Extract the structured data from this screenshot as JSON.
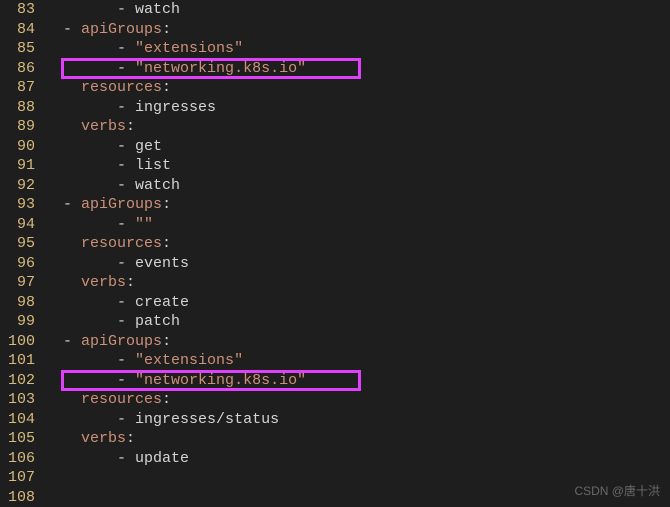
{
  "lines": [
    {
      "num": "83",
      "indent": "        ",
      "dash": "- ",
      "text": "watch",
      "type": "val"
    },
    {
      "num": "84",
      "indent": "  ",
      "dash": "- ",
      "key": "apiGroups",
      "colon": ":"
    },
    {
      "num": "85",
      "indent": "        ",
      "dash": "- ",
      "text": "\"extensions\"",
      "type": "str"
    },
    {
      "num": "86",
      "indent": "        ",
      "dash": "- ",
      "text": "\"networking.k8s.io\"",
      "type": "str",
      "highlight": true
    },
    {
      "num": "87",
      "indent": "    ",
      "key": "resources",
      "colon": ":"
    },
    {
      "num": "88",
      "indent": "        ",
      "dash": "- ",
      "text": "ingresses",
      "type": "val"
    },
    {
      "num": "89",
      "indent": "    ",
      "key": "verbs",
      "colon": ":"
    },
    {
      "num": "90",
      "indent": "        ",
      "dash": "- ",
      "text": "get",
      "type": "val"
    },
    {
      "num": "91",
      "indent": "        ",
      "dash": "- ",
      "text": "list",
      "type": "val"
    },
    {
      "num": "92",
      "indent": "        ",
      "dash": "- ",
      "text": "watch",
      "type": "val"
    },
    {
      "num": "93",
      "indent": "  ",
      "dash": "- ",
      "key": "apiGroups",
      "colon": ":"
    },
    {
      "num": "94",
      "indent": "        ",
      "dash": "- ",
      "text": "\"\"",
      "type": "str"
    },
    {
      "num": "95",
      "indent": "    ",
      "key": "resources",
      "colon": ":"
    },
    {
      "num": "96",
      "indent": "        ",
      "dash": "- ",
      "text": "events",
      "type": "val"
    },
    {
      "num": "97",
      "indent": "    ",
      "key": "verbs",
      "colon": ":"
    },
    {
      "num": "98",
      "indent": "        ",
      "dash": "- ",
      "text": "create",
      "type": "val"
    },
    {
      "num": "99",
      "indent": "        ",
      "dash": "- ",
      "text": "patch",
      "type": "val"
    },
    {
      "num": "100",
      "indent": "  ",
      "dash": "- ",
      "key": "apiGroups",
      "colon": ":"
    },
    {
      "num": "101",
      "indent": "        ",
      "dash": "- ",
      "text": "\"extensions\"",
      "type": "str"
    },
    {
      "num": "102",
      "indent": "        ",
      "dash": "- ",
      "text": "\"networking.k8s.io\"",
      "type": "str",
      "highlight": true
    },
    {
      "num": "103",
      "indent": "    ",
      "key": "resources",
      "colon": ":"
    },
    {
      "num": "104",
      "indent": "        ",
      "dash": "- ",
      "text": "ingresses/status",
      "type": "val"
    },
    {
      "num": "105",
      "indent": "    ",
      "key": "verbs",
      "colon": ":"
    },
    {
      "num": "106",
      "indent": "        ",
      "dash": "- ",
      "text": "update",
      "type": "val"
    },
    {
      "num": "107",
      "indent": "",
      "text": "",
      "type": "empty"
    },
    {
      "num": "108",
      "indent": "",
      "text": "",
      "type": "empty"
    }
  ],
  "watermark": "CSDN @唐十洪"
}
